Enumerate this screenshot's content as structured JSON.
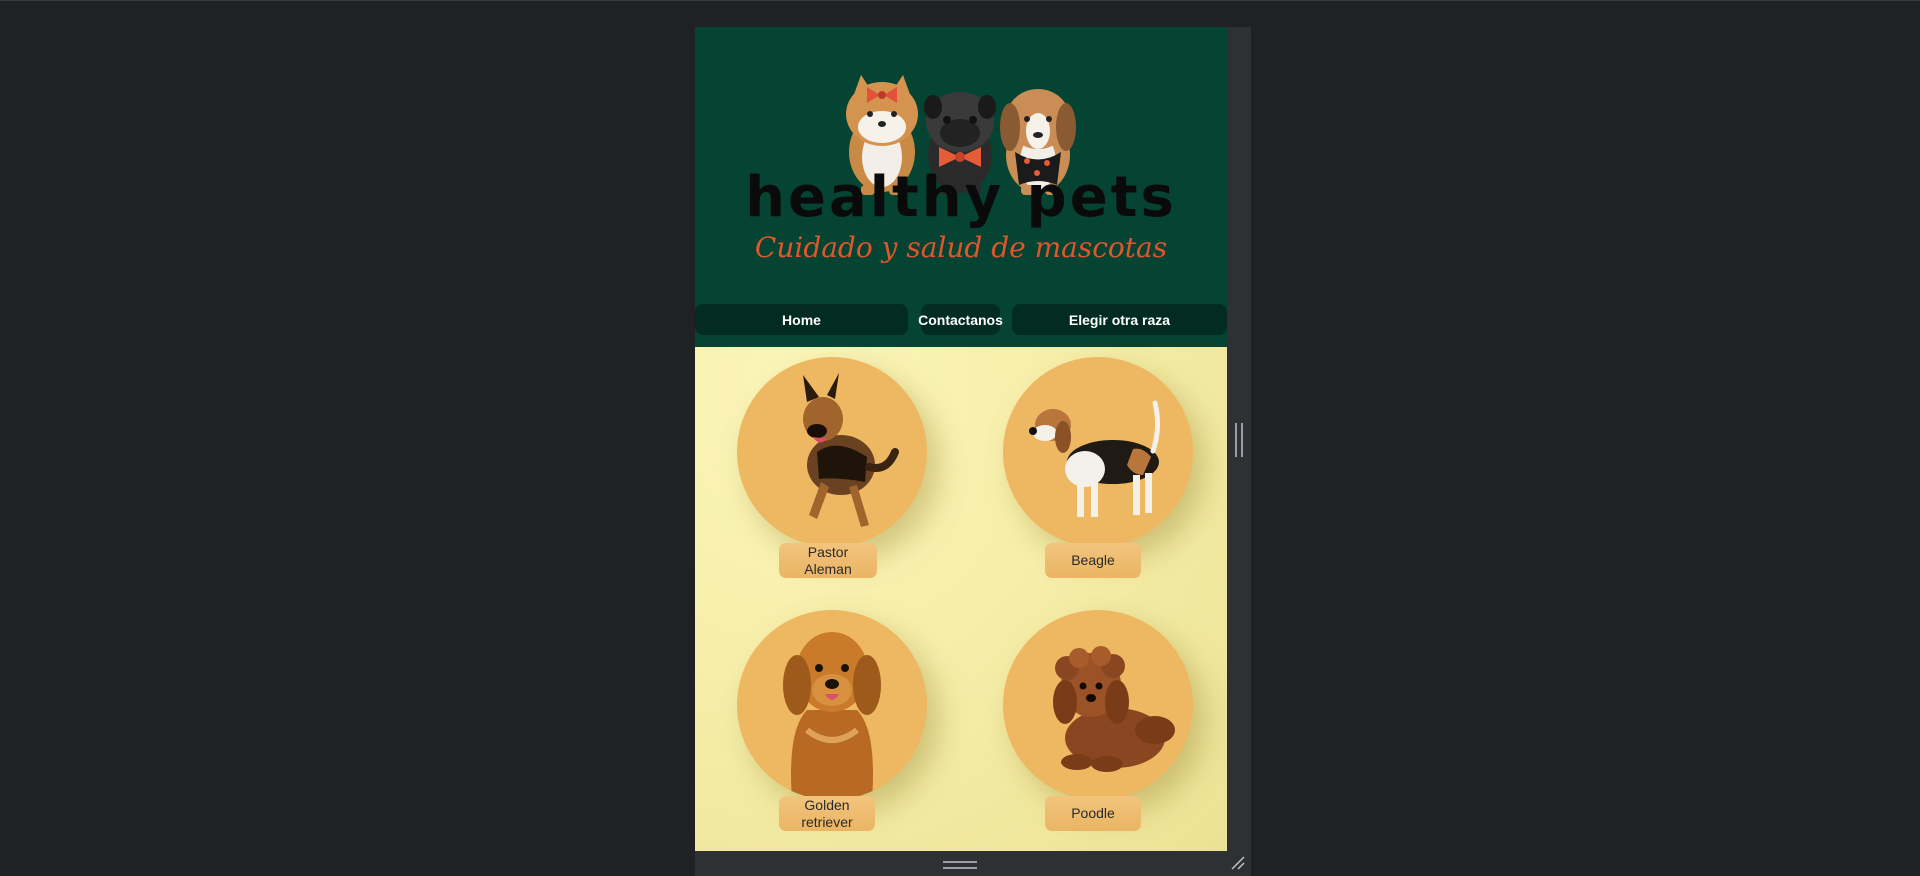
{
  "site": {
    "title": "healthy pets",
    "tagline": "Cuidado y salud de mascotas"
  },
  "nav": {
    "home": "Home",
    "contact": "Contactanos",
    "other_breed": "Elegir otra raza"
  },
  "breeds": [
    {
      "name": "Pastor Aleman",
      "icon": "german-shepherd"
    },
    {
      "name": "Beagle",
      "icon": "beagle"
    },
    {
      "name": "Golden retriever",
      "icon": "golden-retriever"
    },
    {
      "name": "Poodle",
      "icon": "poodle"
    }
  ],
  "colors": {
    "header_bg": "#054432",
    "nav_button_bg": "#032c21",
    "content_bg": "#f6eeaa",
    "circle_bg": "#eeb862",
    "tagline": "#e0562c",
    "page_bg": "#202124"
  }
}
